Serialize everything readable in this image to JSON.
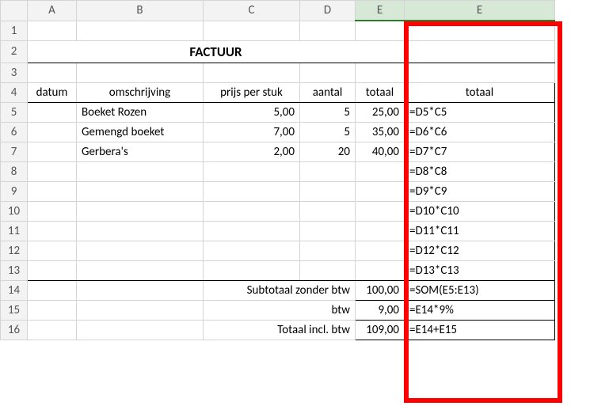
{
  "columns": [
    "",
    "A",
    "B",
    "C",
    "D",
    "E",
    "E"
  ],
  "rows": [
    "1",
    "2",
    "3",
    "4",
    "5",
    "6",
    "7",
    "8",
    "9",
    "10",
    "11",
    "12",
    "13",
    "14",
    "15",
    "16"
  ],
  "title": "FACTUUR",
  "headers": {
    "A": "datum",
    "B": "omschrijving",
    "C": "prijs per stuk",
    "D": "aantal",
    "E": "totaal",
    "F": "totaal"
  },
  "items": [
    {
      "b": "Boeket Rozen",
      "c": "5,00",
      "d": "5",
      "e": "25,00",
      "f": "=D5*C5"
    },
    {
      "b": "Gemengd boeket",
      "c": "7,00",
      "d": "5",
      "e": "35,00",
      "f": "=D6*C6"
    },
    {
      "b": "Gerbera's",
      "c": "2,00",
      "d": "20",
      "e": "40,00",
      "f": "=D7*C7"
    },
    {
      "b": "",
      "c": "",
      "d": "",
      "e": "",
      "f": "=D8*C8"
    },
    {
      "b": "",
      "c": "",
      "d": "",
      "e": "",
      "f": "=D9*C9"
    },
    {
      "b": "",
      "c": "",
      "d": "",
      "e": "",
      "f": "=D10*C10"
    },
    {
      "b": "",
      "c": "",
      "d": "",
      "e": "",
      "f": "=D11*C11"
    },
    {
      "b": "",
      "c": "",
      "d": "",
      "e": "",
      "f": "=D12*C12"
    },
    {
      "b": "",
      "c": "",
      "d": "",
      "e": "",
      "f": "=D13*C13"
    }
  ],
  "totals": [
    {
      "label": "Subtotaal zonder btw",
      "val": "100,00",
      "f": "=SOM(E5:E13)"
    },
    {
      "label": "btw",
      "val": "9,00",
      "f": "=E14*9%"
    },
    {
      "label": "Totaal incl. btw",
      "val": "109,00",
      "f": "=E14+E15"
    }
  ]
}
